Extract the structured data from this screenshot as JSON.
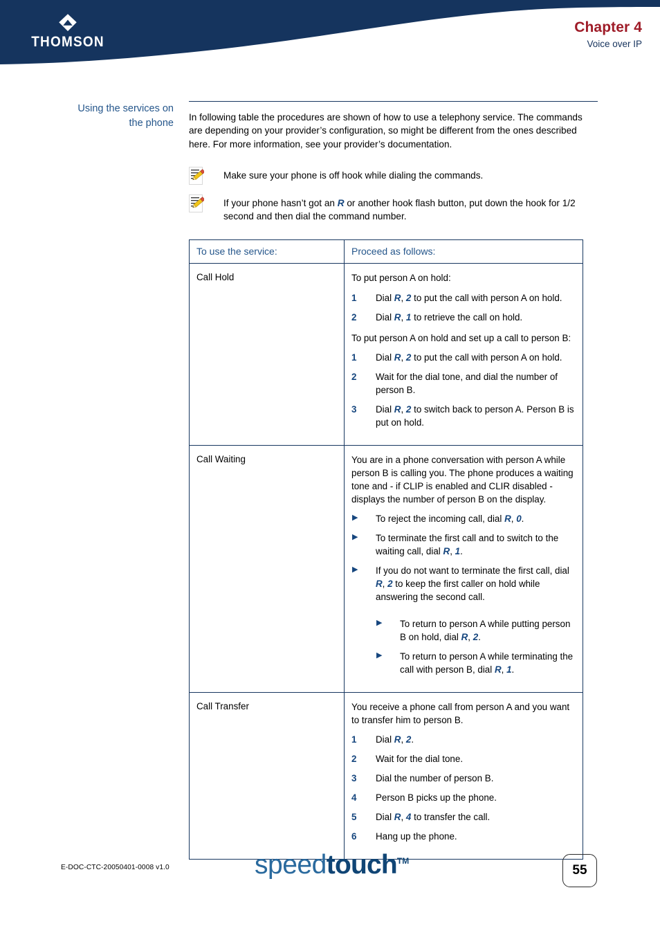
{
  "header": {
    "brand": "THOMSON",
    "brand_icon": "thomson-diamond-logo",
    "chapter": "Chapter 4",
    "chapter_subtitle": "Voice over IP",
    "band_color": "#15345e",
    "chapter_color": "#9e1b27"
  },
  "section": {
    "side_heading": "Using the services on the phone",
    "intro": "In following table the procedures are shown of how to use a telephony service. The commands are depending on your provider’s configuration, so might be different from the ones described here. For more information, see your provider’s documentation."
  },
  "notes": [
    {
      "icon": "note-pencil-icon",
      "segments": [
        {
          "text": "Make sure your phone is off hook while dialing the commands.",
          "style": "plain"
        }
      ]
    },
    {
      "icon": "note-pencil-icon",
      "segments": [
        {
          "text": "If your phone hasn’t got an ",
          "style": "plain"
        },
        {
          "text": "R",
          "style": "cmd"
        },
        {
          "text": " or another hook flash button, put down the hook for 1/2 second and then dial the command number.",
          "style": "plain"
        }
      ]
    }
  ],
  "table": {
    "headers": [
      "To use the service:",
      "Proceed as follows:"
    ],
    "rows": [
      {
        "service": "Call Hold",
        "blocks": [
          {
            "type": "para",
            "segments": [
              {
                "text": "To put person A on hold:",
                "style": "plain"
              }
            ]
          },
          {
            "type": "ol",
            "items": [
              {
                "num": "1",
                "segments": [
                  {
                    "text": "Dial ",
                    "style": "plain"
                  },
                  {
                    "text": "R",
                    "style": "cmd"
                  },
                  {
                    "text": ", ",
                    "style": "plain"
                  },
                  {
                    "text": "2",
                    "style": "cmd"
                  },
                  {
                    "text": " to put the call with person A on hold.",
                    "style": "plain"
                  }
                ]
              },
              {
                "num": "2",
                "segments": [
                  {
                    "text": "Dial ",
                    "style": "plain"
                  },
                  {
                    "text": "R",
                    "style": "cmd"
                  },
                  {
                    "text": ", ",
                    "style": "plain"
                  },
                  {
                    "text": "1",
                    "style": "cmd"
                  },
                  {
                    "text": " to retrieve the call on hold.",
                    "style": "plain"
                  }
                ]
              }
            ]
          },
          {
            "type": "para",
            "segments": [
              {
                "text": "To put person A on hold and set up a call to person B:",
                "style": "plain"
              }
            ]
          },
          {
            "type": "ol",
            "items": [
              {
                "num": "1",
                "segments": [
                  {
                    "text": "Dial ",
                    "style": "plain"
                  },
                  {
                    "text": "R",
                    "style": "cmd"
                  },
                  {
                    "text": ", ",
                    "style": "plain"
                  },
                  {
                    "text": "2",
                    "style": "cmd"
                  },
                  {
                    "text": " to put the call with person A on hold.",
                    "style": "plain"
                  }
                ]
              },
              {
                "num": "2",
                "segments": [
                  {
                    "text": "Wait for the dial tone, and dial the number of person B.",
                    "style": "plain"
                  }
                ]
              },
              {
                "num": "3",
                "segments": [
                  {
                    "text": "Dial ",
                    "style": "plain"
                  },
                  {
                    "text": "R",
                    "style": "cmd"
                  },
                  {
                    "text": ", ",
                    "style": "plain"
                  },
                  {
                    "text": "2",
                    "style": "cmd"
                  },
                  {
                    "text": " to switch back to person A. Person B is put on hold.",
                    "style": "plain"
                  }
                ]
              }
            ]
          }
        ]
      },
      {
        "service": "Call Waiting",
        "blocks": [
          {
            "type": "para",
            "segments": [
              {
                "text": "You are in a phone conversation with person A while person B is calling you. The phone produces a waiting tone and - if CLIP is enabled and CLIR disabled - displays the number of person B on the display.",
                "style": "plain"
              }
            ]
          },
          {
            "type": "ul",
            "items": [
              {
                "marker": "triangle-bullet",
                "segments": [
                  {
                    "text": "To reject the incoming call, dial ",
                    "style": "plain"
                  },
                  {
                    "text": "R",
                    "style": "cmd"
                  },
                  {
                    "text": ", ",
                    "style": "plain"
                  },
                  {
                    "text": "0",
                    "style": "cmd"
                  },
                  {
                    "text": ".",
                    "style": "plain"
                  }
                ]
              },
              {
                "marker": "triangle-bullet",
                "segments": [
                  {
                    "text": "To terminate the first call and to switch to the waiting call, dial ",
                    "style": "plain"
                  },
                  {
                    "text": "R",
                    "style": "cmd"
                  },
                  {
                    "text": ", ",
                    "style": "plain"
                  },
                  {
                    "text": "1",
                    "style": "cmd"
                  },
                  {
                    "text": ".",
                    "style": "plain"
                  }
                ]
              },
              {
                "marker": "triangle-bullet",
                "segments": [
                  {
                    "text": "If you do not want to terminate the first call, dial ",
                    "style": "plain"
                  },
                  {
                    "text": "R",
                    "style": "cmd"
                  },
                  {
                    "text": ", ",
                    "style": "plain"
                  },
                  {
                    "text": "2",
                    "style": "cmd"
                  },
                  {
                    "text": " to keep the first caller on hold while answering the second call.",
                    "style": "plain"
                  }
                ]
              }
            ]
          },
          {
            "type": "ul-nested",
            "items": [
              {
                "marker": "triangle-bullet",
                "segments": [
                  {
                    "text": "To return to person A while putting person B on hold, dial ",
                    "style": "plain"
                  },
                  {
                    "text": "R",
                    "style": "cmd"
                  },
                  {
                    "text": ", ",
                    "style": "plain"
                  },
                  {
                    "text": "2",
                    "style": "cmd"
                  },
                  {
                    "text": ".",
                    "style": "plain"
                  }
                ]
              },
              {
                "marker": "triangle-bullet",
                "segments": [
                  {
                    "text": "To return to person A while terminating the call with person B, dial ",
                    "style": "plain"
                  },
                  {
                    "text": "R",
                    "style": "cmd"
                  },
                  {
                    "text": ", ",
                    "style": "plain"
                  },
                  {
                    "text": "1",
                    "style": "cmd"
                  },
                  {
                    "text": ".",
                    "style": "plain"
                  }
                ]
              }
            ]
          }
        ]
      },
      {
        "service": "Call Transfer",
        "blocks": [
          {
            "type": "para",
            "segments": [
              {
                "text": "You receive a phone call from person A and you want to transfer him to person B.",
                "style": "plain"
              }
            ]
          },
          {
            "type": "ol",
            "items": [
              {
                "num": "1",
                "segments": [
                  {
                    "text": "Dial ",
                    "style": "plain"
                  },
                  {
                    "text": "R",
                    "style": "cmd"
                  },
                  {
                    "text": ", ",
                    "style": "plain"
                  },
                  {
                    "text": "2",
                    "style": "cmd"
                  },
                  {
                    "text": ".",
                    "style": "plain"
                  }
                ]
              },
              {
                "num": "2",
                "segments": [
                  {
                    "text": "Wait for the dial tone.",
                    "style": "plain"
                  }
                ]
              },
              {
                "num": "3",
                "segments": [
                  {
                    "text": "Dial the number of person B.",
                    "style": "plain"
                  }
                ]
              },
              {
                "num": "4",
                "segments": [
                  {
                    "text": "Person B picks up the phone.",
                    "style": "plain"
                  }
                ]
              },
              {
                "num": "5",
                "segments": [
                  {
                    "text": "Dial ",
                    "style": "plain"
                  },
                  {
                    "text": "R",
                    "style": "cmd"
                  },
                  {
                    "text": ", ",
                    "style": "plain"
                  },
                  {
                    "text": "4",
                    "style": "cmd"
                  },
                  {
                    "text": " to transfer the call.",
                    "style": "plain"
                  }
                ]
              },
              {
                "num": "6",
                "segments": [
                  {
                    "text": "Hang up the phone.",
                    "style": "plain"
                  }
                ]
              }
            ]
          }
        ]
      }
    ]
  },
  "footer": {
    "doc_code": "E-DOC-CTC-20050401-0008 v1.0",
    "brand_speed": "speed",
    "brand_touch": "touch",
    "brand_tm": "TM",
    "page_number": "55"
  },
  "colors": {
    "navy": "#15345e",
    "heading_blue": "#25568b",
    "command_blue": "#16467e",
    "chapter_red": "#9e1b27",
    "brand_light": "#2a6a9e",
    "brand_dark": "#104575"
  }
}
